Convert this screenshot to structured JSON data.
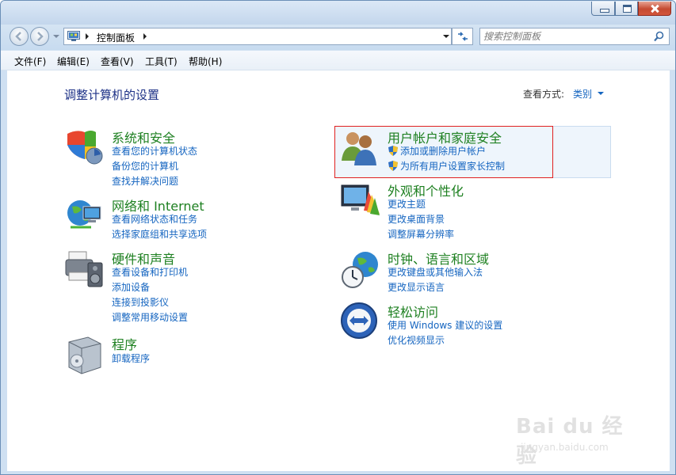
{
  "window": {
    "min_label": "",
    "max_label": "",
    "close_label": ""
  },
  "address": {
    "breadcrumb": "控制面板"
  },
  "search": {
    "placeholder": "搜索控制面板"
  },
  "menu": [
    "文件(F)",
    "编辑(E)",
    "查看(V)",
    "工具(T)",
    "帮助(H)"
  ],
  "page": {
    "title": "调整计算机的设置",
    "view_by_label": "查看方式:",
    "view_by_value": "类别"
  },
  "categories_left": [
    {
      "title": "系统和安全",
      "icon": "shield-security-icon",
      "links": [
        "查看您的计算机状态",
        "备份您的计算机",
        "查找并解决问题"
      ]
    },
    {
      "title": "网络和 Internet",
      "icon": "network-globe-icon",
      "links": [
        "查看网络状态和任务",
        "选择家庭组和共享选项"
      ]
    },
    {
      "title": "硬件和声音",
      "icon": "printer-speaker-icon",
      "links": [
        "查看设备和打印机",
        "添加设备",
        "连接到投影仪",
        "调整常用移动设置"
      ]
    },
    {
      "title": "程序",
      "icon": "programs-box-icon",
      "links": [
        "卸载程序"
      ]
    }
  ],
  "categories_right": [
    {
      "title": "用户帐户和家庭安全",
      "icon": "users-icon",
      "links": [
        "添加或删除用户帐户",
        "为所有用户设置家长控制"
      ]
    },
    {
      "title": "外观和个性化",
      "icon": "monitor-palette-icon",
      "links": [
        "更改主题",
        "更改桌面背景",
        "调整屏幕分辨率"
      ]
    },
    {
      "title": "时钟、语言和区域",
      "icon": "clock-globe-icon",
      "links": [
        "更改键盘或其他输入法",
        "更改显示语言"
      ]
    },
    {
      "title": "轻松访问",
      "icon": "ease-of-access-icon",
      "links": [
        "使用 Windows 建议的设置",
        "优化视频显示"
      ]
    }
  ],
  "watermark": {
    "brand": "Bai du 经验",
    "url": "jingyan.baidu.com"
  },
  "colors": {
    "link": "#1565c0",
    "category_title": "#1e8021",
    "page_title": "#1e3287",
    "highlight_border": "#e02020"
  }
}
